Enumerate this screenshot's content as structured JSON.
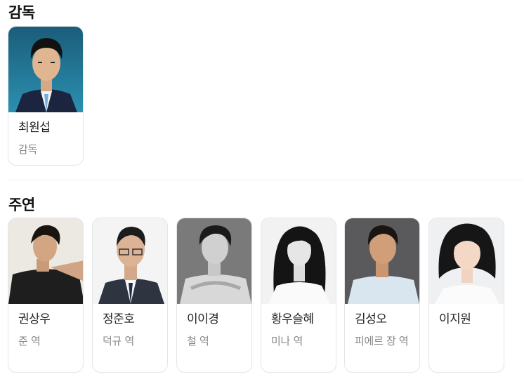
{
  "director_section": {
    "title": "감독",
    "people": [
      {
        "name": "최원섭",
        "role": "감독",
        "photo": "director-photo"
      }
    ]
  },
  "cast_section": {
    "title": "주연",
    "people": [
      {
        "name": "권상우",
        "role": "준 역"
      },
      {
        "name": "정준호",
        "role": "덕규 역"
      },
      {
        "name": "이이경",
        "role": "철 역"
      },
      {
        "name": "황우슬혜",
        "role": "미나 역"
      },
      {
        "name": "김성오",
        "role": "피에르 장 역"
      },
      {
        "name": "이지원",
        "role": ""
      }
    ]
  },
  "colors": {
    "card_border": "#e3e5e8",
    "role_text": "#888888",
    "name_text": "#222222"
  }
}
